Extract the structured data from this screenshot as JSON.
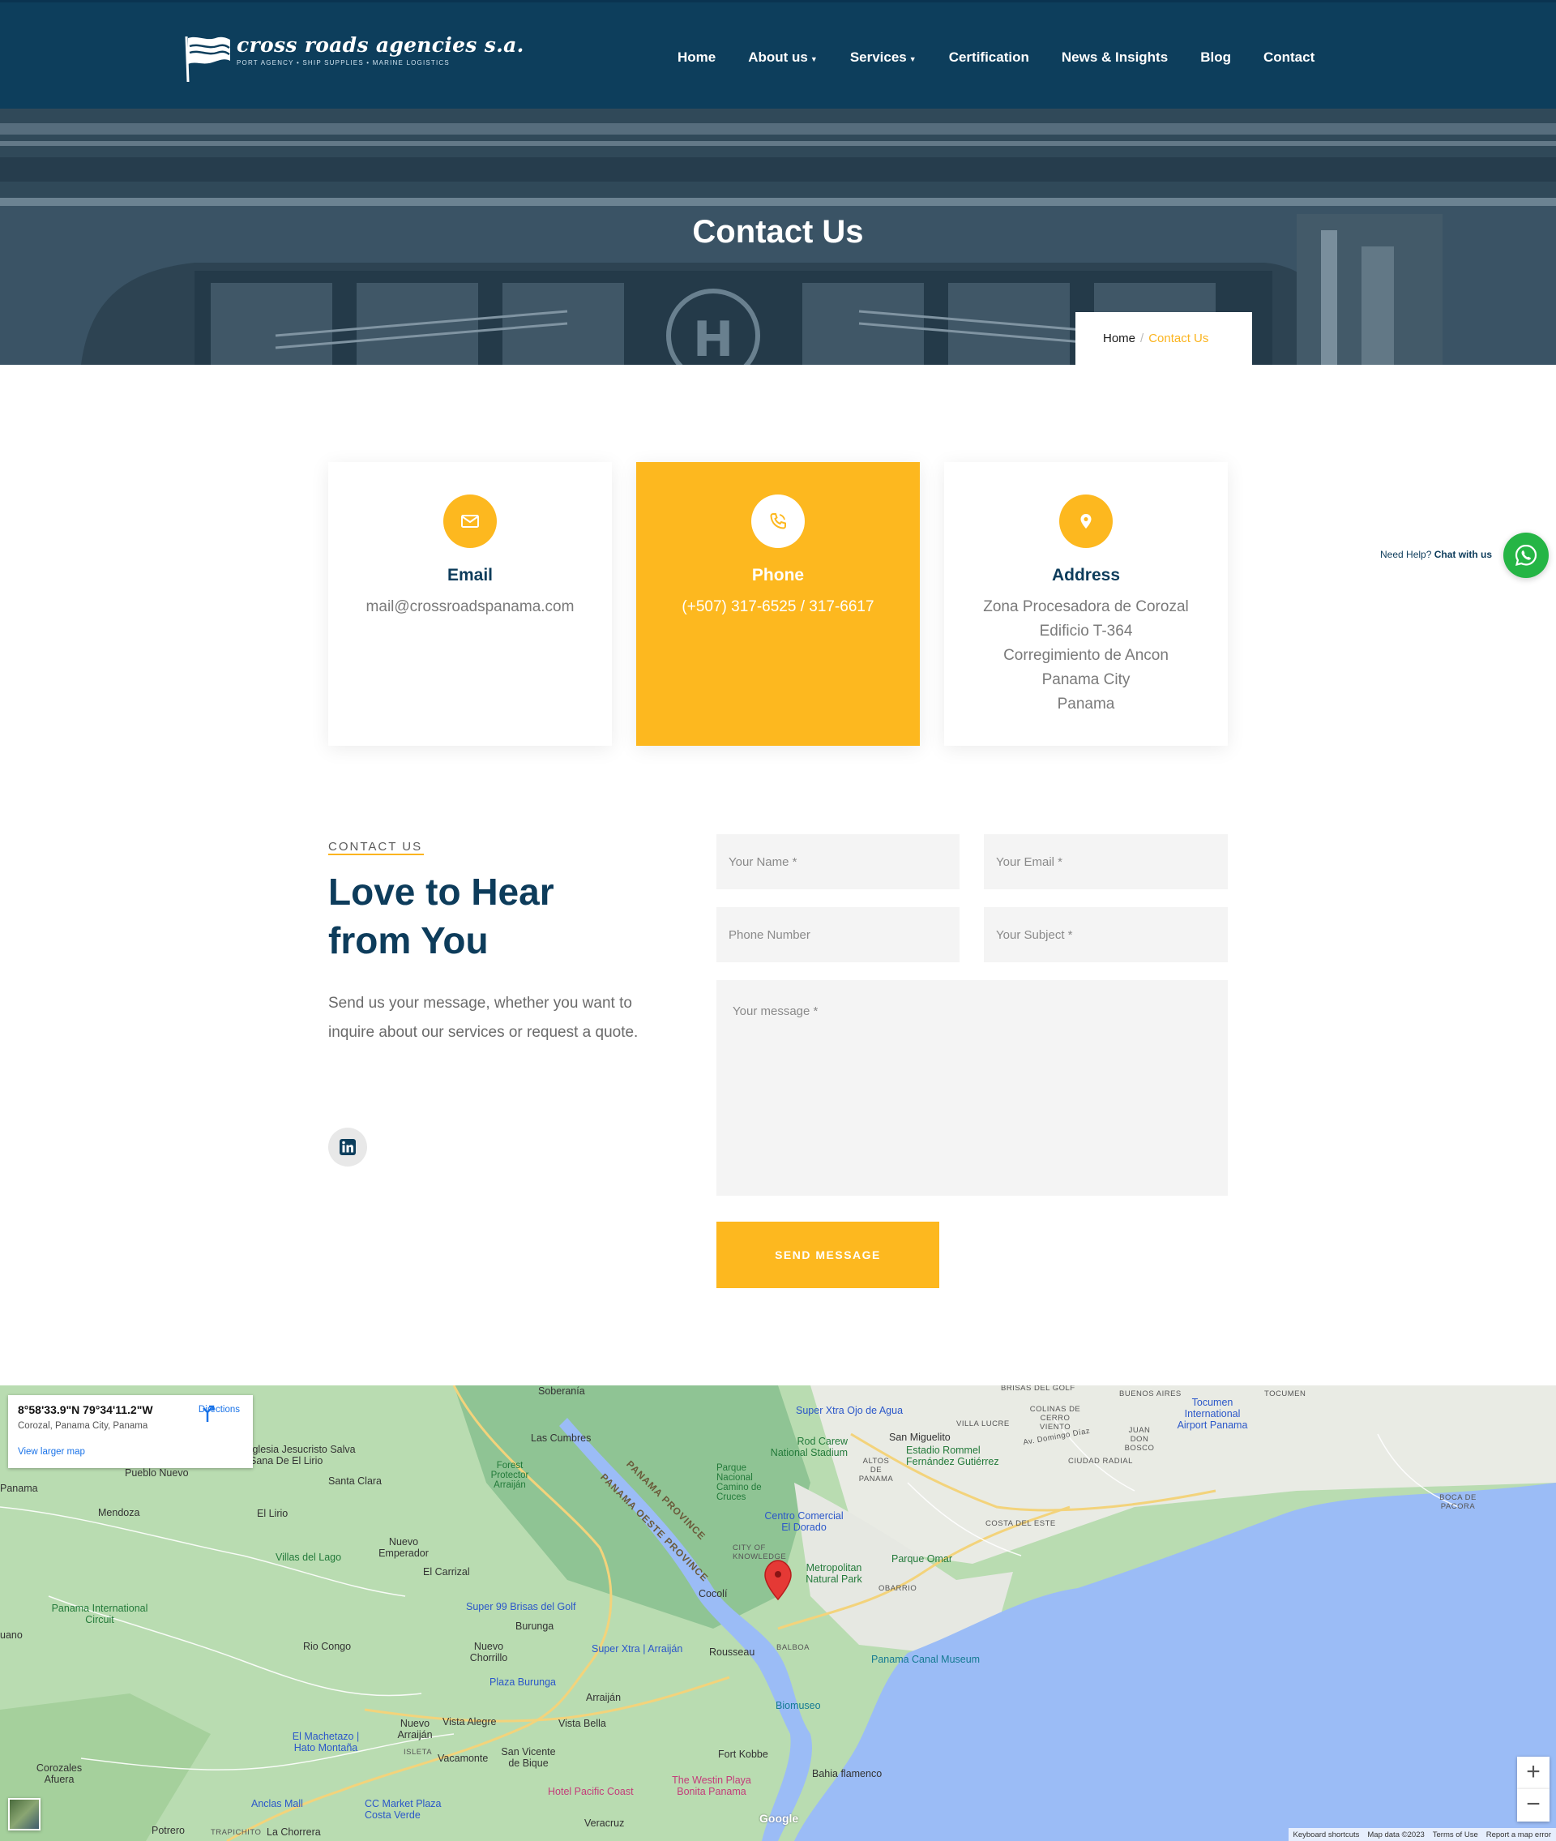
{
  "brand": {
    "name": "cross roads agencies s.a.",
    "tagline": "PORT AGENCY  •  SHIP SUPPLIES  •  MARINE LOGISTICS"
  },
  "nav": {
    "items": [
      {
        "label": "Home"
      },
      {
        "label": "About us"
      },
      {
        "label": "Services"
      },
      {
        "label": "Certification"
      },
      {
        "label": "News & Insights"
      },
      {
        "label": "Blog"
      },
      {
        "label": "Contact"
      }
    ]
  },
  "hero": {
    "title": "Contact Us",
    "breadcrumb_home": "Home",
    "breadcrumb_sep": "/",
    "breadcrumb_current": "Contact Us"
  },
  "cards": {
    "email": {
      "title": "Email",
      "text": "mail@crossroadspanama.com",
      "icon": "envelope-icon"
    },
    "phone": {
      "title": "Phone",
      "text": "(+507) 317-6525 / 317-6617",
      "icon": "phone-icon"
    },
    "address": {
      "title": "Address",
      "icon": "map-pin-icon",
      "lines": [
        "Zona Procesadora de Corozal",
        "Edificio T-364",
        "Corregimiento de Ancon",
        "Panama City",
        "Panama"
      ]
    }
  },
  "whatsapp": {
    "prefix": "Need Help?",
    "label": "Chat with us"
  },
  "contact": {
    "eyebrow": "CONTACT US",
    "headline_line1": "Love to Hear",
    "headline_line2": "from You",
    "lead": "Send us your message, whether you want to inquire about our services or request a quote.",
    "social_icon": "linkedin-icon"
  },
  "form": {
    "name_placeholder": "Your Name *",
    "email_placeholder": "Your Email *",
    "phone_placeholder": "Phone Number",
    "subject_placeholder": "Your Subject *",
    "message_placeholder": "Your message *",
    "submit_label": "SEND MESSAGE"
  },
  "map": {
    "info_coords": "8°58'33.9\"N 79°34'11.2\"W",
    "info_address": "Corozal, Panama City, Panama",
    "info_link": "View larger map",
    "directions_label": "Directions",
    "zoom_in": "+",
    "zoom_out": "−",
    "google_logo": "Google",
    "attribution": [
      "Keyboard shortcuts",
      "Map data ©2023",
      "Terms of Use",
      "Report a map error"
    ],
    "labels": [
      "Soberanía",
      "Las Cumbres",
      "Super Xtra Ojo de Agua",
      "San Miguelito",
      "Rod Carew National Stadium",
      "Estadio Rommel Fernández Gutiérrez",
      "Tocumen International Airport Panama",
      "Iglesia Jesucristo Salva Sana De El Lirio",
      "Pueblo Nuevo",
      "Santa Clara",
      "Forest Protector Arraiján",
      "Parque Nacional Camino de Cruces",
      "Mendoza",
      "El Lirio",
      "Centro Comercial El Dorado",
      "Nuevo Emperador",
      "Villas del Lago",
      "El Carrizal",
      "Metropolitan Natural Park",
      "Parque Omar",
      "Panama International Circuit",
      "Super 99 Brisas del Golf",
      "Cocolí",
      "Burunga",
      "Rio Congo",
      "Nuevo Chorrillo",
      "Super Xtra | Arraiján",
      "Rousseau",
      "Panama Canal Museum",
      "Plaza Burunga",
      "Arraiján",
      "Biomuseo",
      "Nuevo Arraiján",
      "Vista Alegre",
      "Vista Bella",
      "El Machetazo | Hato Montaña",
      "Vacamonte",
      "San Vicente de Bique",
      "Fort Kobbe",
      "Bahia flamenco",
      "Corozales Afuera",
      "Hotel Pacific Coast",
      "The Westin Playa Bonita Panama",
      "Anclas Mall",
      "CC Market Plaza Costa Verde",
      "Potrero",
      "La Chorrera",
      "Veracruz",
      "PANAMA PROVINCE",
      "PANAMA OESTE PROVINCE",
      "VILLA LUCRE",
      "COLINAS DE CERRO VIENTO",
      "BUENOS AIRES",
      "TOCUMEN",
      "JUAN DON BOSCO",
      "CIUDAD RADIAL",
      "ALTOS DE PANAMA",
      "COSTA DEL ESTE",
      "CITY OF KNOWLEDGE",
      "OBARRIO",
      "BALBOA",
      "ISLETA",
      "TRAPICHITO",
      "BOCA DE PACORA",
      "BRISAS DEL GOLF",
      "Av. Domingo Díaz",
      "Panama",
      "uano"
    ]
  },
  "colors": {
    "navy": "#0d3e5c",
    "accent": "#fdb81f",
    "whatsapp": "#25b545"
  }
}
